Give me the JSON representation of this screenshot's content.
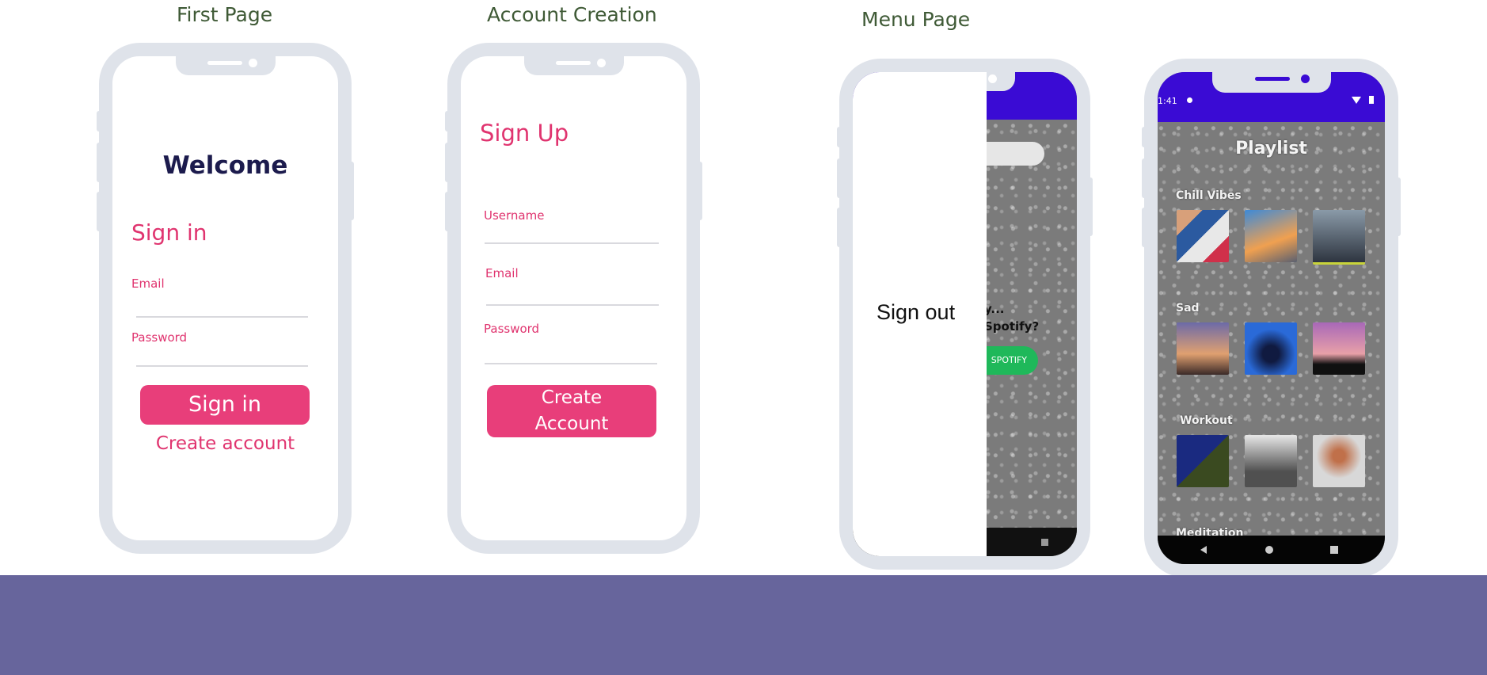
{
  "captions": {
    "first": "First Page",
    "account": "Account Creation",
    "menu": "Menu Page"
  },
  "signin_screen": {
    "welcome": "Welcome",
    "heading": "Sign in",
    "email_label": "Email",
    "password_label": "Password",
    "signin_button": "Sign in",
    "create_account_link": "Create account"
  },
  "signup_screen": {
    "heading": "Sign Up",
    "username_label": "Username",
    "email_label": "Email",
    "password_label": "Password",
    "create_button_line1": "Create",
    "create_button_line2": "Account"
  },
  "menu_screen": {
    "drawer_item": "Sign out",
    "partial_text_1": "y...",
    "partial_text_2": "Spotify?",
    "partial_button": "SPOTIFY"
  },
  "playlist_screen": {
    "status_time": "1:41",
    "title": "Playlist",
    "categories": [
      "Chill Vibes",
      "Sad",
      "Workout",
      "Meditation"
    ]
  },
  "colors": {
    "accent_pink": "#e83e7a",
    "status_bar_purple": "#3a0bd4",
    "phone_frame": "#dfe3ea",
    "footer_band": "#67659c"
  }
}
